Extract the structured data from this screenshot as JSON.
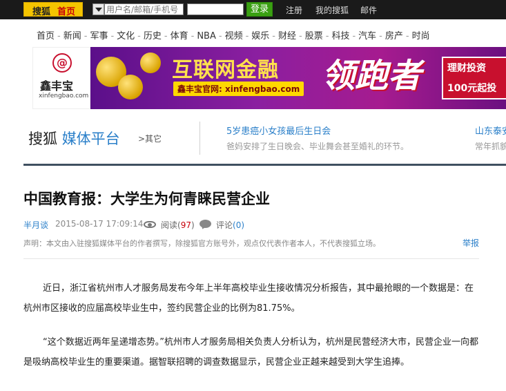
{
  "topbar": {
    "brand_sohu": "搜狐",
    "brand_home": "首页",
    "username_placeholder": "用户名/邮箱/手机号",
    "login_label": "登录",
    "links": [
      "注册",
      "我的搜狐",
      "邮件"
    ]
  },
  "nav": {
    "items": [
      "首页",
      "新闻",
      "军事",
      "文化",
      "历史",
      "体育",
      "NBA",
      "视频",
      "娱乐",
      "财经",
      "股票",
      "科技",
      "汽车",
      "房产",
      "时尚"
    ],
    "separator": "-"
  },
  "banner": {
    "logo_glyph": "@",
    "logo_cn": "鑫丰宝",
    "logo_en": "xinfengbao.com",
    "ad_title": "互联网金融",
    "ad_site": "鑫丰宝官网: xinfengbao.com",
    "ad_slogan": "领跑者",
    "ad_right_line1": "理财投资",
    "ad_right_line2": "100元起投"
  },
  "media_header": {
    "logo_sohu": "搜狐",
    "logo_platform": "媒体平台",
    "other_link": ">其它",
    "headline1_title": "5岁患癌小女孩最后生日会",
    "headline1_sub": "爸妈安排了生日晚会、毕业舞会甚至婚礼的环节。",
    "headline2_title": "山东泰安",
    "headline2_sub": "常年抓貌"
  },
  "article": {
    "title": "中国教育报：大学生为何青睐民营企业",
    "author": "半月谈",
    "datetime": "2015-08-17 17:09:14",
    "read_label": "阅读",
    "read_open": "(",
    "read_count": "97",
    "read_close": ")",
    "comment_label": "评论",
    "comment_count": "(0)",
    "statement": "声明：本文由入驻搜狐媒体平台的作者撰写，除搜狐官方账号外，观点仅代表作者本人，不代表搜狐立场。",
    "report_label": "举报",
    "paragraphs": [
      "近日，浙江省杭州市人才服务局发布今年上半年高校毕业生接收情况分析报告，其中最抢眼的一个数据是：在杭州市区接收的应届高校毕业生中，签约民营企业的比例为81.75%。",
      "“这个数据近两年呈递增态势。”杭州市人才服务局相关负责人分析认为，杭州是民营经济大市，民营企业一向都是吸纳高校毕业生的重要渠道。据智联招聘的调查数据显示，民营企业正越来越受到大学生追捧。"
    ]
  },
  "colors": {
    "brand_yellow": "#f4c400",
    "link_blue": "#2a7fc9",
    "login_green": "#3aa012",
    "topbar_bg": "#1a1a1a",
    "count_red": "#c8000a"
  }
}
